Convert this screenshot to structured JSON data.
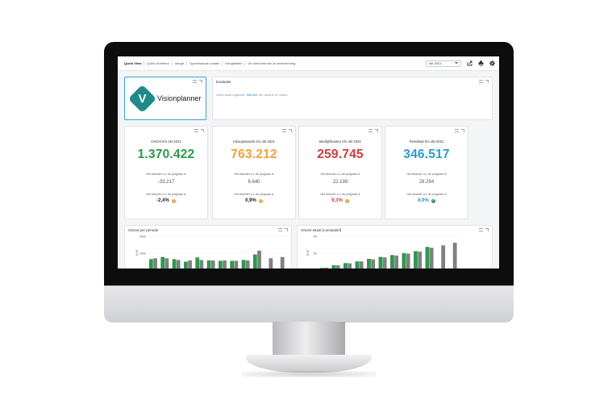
{
  "header": {
    "tabs": [
      {
        "label": "Quick View",
        "active": true
      },
      {
        "label": "Quick Numbers",
        "active": false
      },
      {
        "label": "Marge",
        "active": false
      },
      {
        "label": "Openstaande posten",
        "active": false
      },
      {
        "label": "Kengetallen",
        "active": false
      },
      {
        "label": "De toekomst van je onderneming",
        "active": false
      }
    ],
    "period": "okt 2021",
    "icons": [
      "export-icon",
      "print-icon",
      "gear-icon"
    ]
  },
  "logo": {
    "brand": "Visionplanner",
    "mark": "V"
  },
  "evaluation": {
    "title": "Evaluatie",
    "text_before": "Geen tekst ingevuld.",
    "link": "Klik hier",
    "text_after": "om tekst in te vullen."
  },
  "kpis": [
    {
      "title": "Omzet t/m okt 2021",
      "value": "1.370.422",
      "color": "#2a9a4a",
      "caption1": "Het verschil t.o.v. de prognose is",
      "diff": "-33.217",
      "caption2": "Het verschil t.o.v. de prognose is",
      "pct": "-2,4%",
      "pct_color": "#222222",
      "status": "warning",
      "status_color": "#f0a23a"
    },
    {
      "title": "Inkoopwaarde t/m okt 2021",
      "value": "763.212",
      "color": "#f0a23a",
      "caption1": "Het verschil t.o.v. de prognose is",
      "diff": "6.640",
      "caption2": "Het verschil t.o.v. de prognose is",
      "pct": "0,9%",
      "pct_color": "#222222",
      "status": "warning",
      "status_color": "#f0a23a"
    },
    {
      "title": "Bedrijfskosten t/m okt 2021",
      "value": "259.745",
      "color": "#d63a3a",
      "caption1": "Het verschil t.o.v. de prognose is",
      "diff": "22.199",
      "caption2": "Het verschil t.o.v. de prognose is",
      "pct": "9,3%",
      "pct_color": "#d63a3a",
      "status": "warning",
      "status_color": "#f0a23a"
    },
    {
      "title": "Resultaat t/m okt 2021",
      "value": "346.517",
      "color": "#2b9bd1",
      "caption1": "Het verschil t.o.v. de prognose is",
      "diff": "28.264",
      "caption2": "Het verschil t.o.v. de prognose is",
      "pct": "8,9%",
      "pct_color": "#2b9bd1",
      "status": "ok",
      "status_color": "#2a9a4a"
    }
  ],
  "chart_data": [
    {
      "type": "bar",
      "title": "Omzet per periode",
      "ylabel": "EUR",
      "yticks": [
        "400k",
        "200k",
        "0"
      ],
      "ylim": [
        0,
        400000
      ],
      "categories": [
        "1",
        "2",
        "3",
        "4",
        "5",
        "6",
        "7",
        "8",
        "9",
        "10",
        "11",
        "12"
      ],
      "series": [
        {
          "color": "#2a9a4a",
          "values": [
            130000,
            155000,
            130000,
            100000,
            150000,
            115000,
            110000,
            110000,
            120000,
            185000,
            null,
            null
          ]
        },
        {
          "color": "#808080",
          "values": [
            140000,
            140000,
            120000,
            115000,
            120000,
            115000,
            115000,
            110000,
            115000,
            230000,
            140000,
            155000
          ]
        }
      ]
    },
    {
      "type": "bar",
      "title": "Omzet totaal (cumulatief)",
      "ylabel": "EUR",
      "yticks": [
        "2M",
        "1M",
        "0"
      ],
      "ylim": [
        0,
        2000000
      ],
      "categories": [
        "1",
        "2",
        "3",
        "4",
        "5",
        "6",
        "7",
        "8",
        "9",
        "10",
        "11",
        "12"
      ],
      "series": [
        {
          "color": "#2a9a4a",
          "values": [
            130000,
            285000,
            415000,
            515000,
            665000,
            780000,
            890000,
            1000000,
            1120000,
            1370000,
            null,
            null
          ]
        },
        {
          "color": "#808080",
          "values": [
            140000,
            280000,
            400000,
            515000,
            635000,
            750000,
            865000,
            975000,
            1090000,
            1320000,
            1460000,
            1615000
          ]
        }
      ]
    }
  ]
}
